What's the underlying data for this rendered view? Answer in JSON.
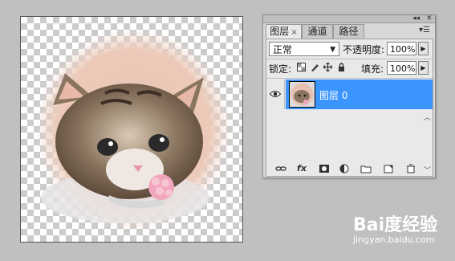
{
  "panel": {
    "tabs": [
      {
        "label": "图层",
        "close": "×"
      },
      {
        "label": "通道"
      },
      {
        "label": "路径"
      }
    ],
    "window_buttons": {
      "collapse": "◂◂",
      "close": "✕"
    },
    "menu_icon": "panel-menu-icon",
    "blend_mode": "正常",
    "opacity_label": "不透明度:",
    "opacity_value": "100%",
    "lock_label": "锁定:",
    "fill_label": "填充:",
    "fill_value": "100%",
    "layers": [
      {
        "name": "图层 0",
        "visible": true,
        "selected": true
      }
    ],
    "footer_icons": [
      "link-icon",
      "fx-icon",
      "mask-icon",
      "adjustment-icon",
      "folder-icon",
      "new-layer-icon",
      "trash-icon"
    ],
    "fx_label": "fx"
  },
  "watermark": {
    "brand": "Bai度经验",
    "url": "jingyan.baidu.com"
  },
  "colors": {
    "selected_row": "#3b95ff",
    "panel_bg": "#e9e9e9",
    "app_bg": "#c0c0c0"
  }
}
